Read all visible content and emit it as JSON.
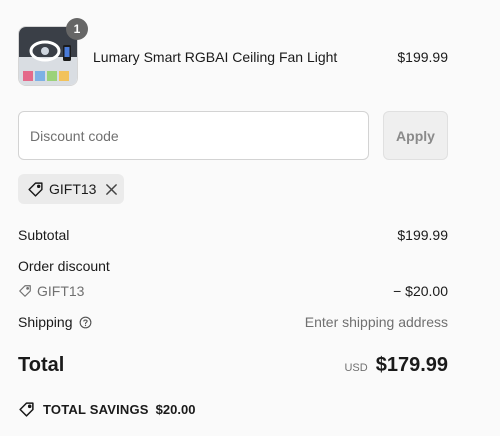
{
  "cart": {
    "item": {
      "quantity": "1",
      "name": "Lumary Smart RGBAI Ceiling Fan Light",
      "price": "$199.99"
    }
  },
  "discount": {
    "placeholder": "Discount code",
    "apply_label": "Apply",
    "applied_code": "GIFT13"
  },
  "summary": {
    "subtotal_label": "Subtotal",
    "subtotal_value": "$199.99",
    "order_discount_label": "Order discount",
    "discount_code": "GIFT13",
    "discount_value": "− $20.00",
    "shipping_label": "Shipping",
    "shipping_value": "Enter shipping address",
    "total_label": "Total",
    "currency": "USD",
    "total_value": "$179.99",
    "savings_label": "TOTAL SAVINGS",
    "savings_value": "$20.00"
  },
  "icons": {
    "tag": "tag-icon",
    "remove": "close-icon",
    "info": "question-circle-icon",
    "savings": "tag-icon"
  },
  "colors": {
    "background": "#fafafa",
    "badge": "#666666",
    "chip": "#ebebeb",
    "muted_text": "#707070"
  }
}
